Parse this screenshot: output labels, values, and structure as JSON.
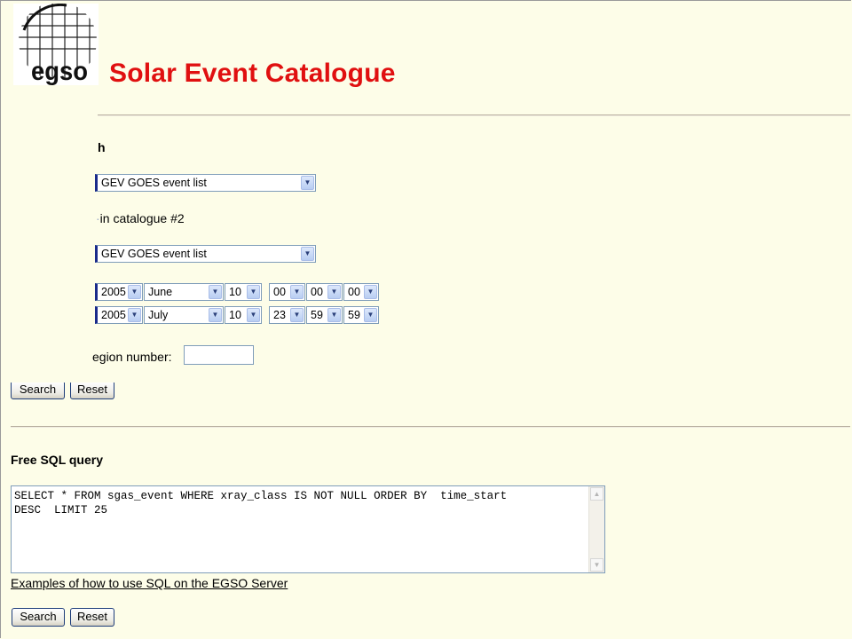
{
  "header": {
    "logo_text": "egso",
    "title": "Solar Event Catalogue"
  },
  "search": {
    "heading_fragment": "h",
    "catalogue1_value": "GEV GOES event list",
    "catalogue2_label": "in catalogue #2",
    "catalogue2_value": "GEV GOES event list",
    "start": {
      "year": "2005",
      "month": "June",
      "day": "10",
      "hour": "00",
      "minute": "00",
      "second": "00"
    },
    "end": {
      "year": "2005",
      "month": "July",
      "day": "10",
      "hour": "23",
      "minute": "59",
      "second": "59"
    },
    "region_label": "egion number:",
    "region_value": "",
    "search_label": "Search",
    "reset_label": "Reset"
  },
  "sql": {
    "heading": "Free SQL query",
    "query": "SELECT * FROM sgas_event WHERE xray_class IS NOT NULL ORDER BY  time_start\nDESC  LIMIT 25",
    "examples_link": "Examples of how to use SQL on the EGSO Server",
    "search_label": "Search",
    "reset_label": "Reset"
  },
  "icons": {
    "dropdown": "chevron-down-icon",
    "scroll_up": "scroll-up-icon",
    "scroll_down": "scroll-down-icon"
  },
  "colors": {
    "background": "#fdfde8",
    "title": "#e01010",
    "select_accent": "#1a2a8a"
  }
}
